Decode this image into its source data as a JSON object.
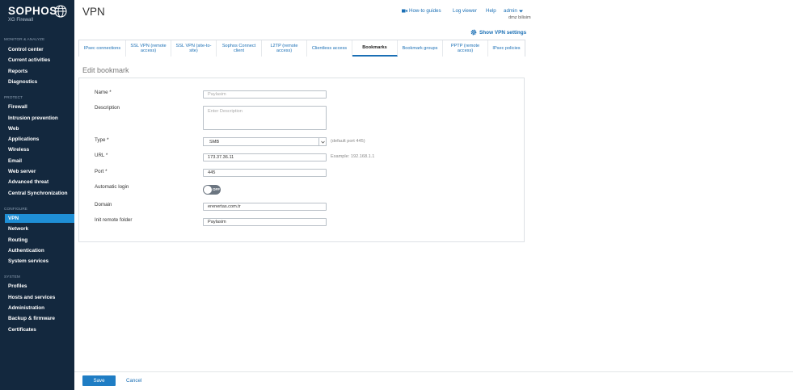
{
  "brand": {
    "name": "SOPHOS",
    "product": "XG Firewall"
  },
  "sidebar": {
    "sections": [
      {
        "label": "MONITOR & ANALYZE",
        "items": [
          "Control center",
          "Current activities",
          "Reports",
          "Diagnostics"
        ]
      },
      {
        "label": "PROTECT",
        "items": [
          "Firewall",
          "Intrusion prevention",
          "Web",
          "Applications",
          "Wireless",
          "Email",
          "Web server",
          "Advanced threat",
          "Central Synchronization"
        ]
      },
      {
        "label": "CONFIGURE",
        "items": [
          "VPN",
          "Network",
          "Routing",
          "Authentication",
          "System services"
        ]
      },
      {
        "label": "SYSTEM",
        "items": [
          "Profiles",
          "Hosts and services",
          "Administration",
          "Backup & firmware",
          "Certificates"
        ]
      }
    ],
    "active_item": "VPN"
  },
  "header": {
    "title": "VPN",
    "how_to": "How-to guides",
    "log_viewer": "Log viewer",
    "help": "Help",
    "user": "admin",
    "host": "dmz bilisim",
    "show_settings": "Show VPN settings"
  },
  "tabs": [
    {
      "label": "IPsec connections",
      "active": false
    },
    {
      "label": "SSL VPN (remote access)",
      "active": false
    },
    {
      "label": "SSL VPN (site-to-site)",
      "active": false
    },
    {
      "label": "Sophos Connect client",
      "active": false
    },
    {
      "label": "L2TP (remote access)",
      "active": false
    },
    {
      "label": "Clientless access",
      "active": false
    },
    {
      "label": "Bookmarks",
      "active": true
    },
    {
      "label": "Bookmark groups",
      "active": false
    },
    {
      "label": "PPTP (remote access)",
      "active": false
    },
    {
      "label": "IPsec policies",
      "active": false
    }
  ],
  "form": {
    "section_title": "Edit bookmark",
    "name": {
      "label": "Name *",
      "value": "",
      "placeholder": "Paylasim"
    },
    "description": {
      "label": "Description",
      "value": "",
      "placeholder": "Enter Description"
    },
    "type": {
      "label": "Type *",
      "value": "SMB",
      "hint": "(default port 445)"
    },
    "url": {
      "label": "URL *",
      "value": "173.37.36.11",
      "hint": "Example: 192.168.1.1"
    },
    "port": {
      "label": "Port *",
      "value": "445"
    },
    "auto_login": {
      "label": "Automatic login",
      "state": "OFF"
    },
    "domain": {
      "label": "Domain",
      "value": "erenertas.com.tr"
    },
    "init_folder": {
      "label": "Init remote folder",
      "value": "Paylasim"
    }
  },
  "footer": {
    "save": "Save",
    "cancel": "Cancel"
  },
  "colors": {
    "sidebar_bg": "#13283e",
    "accent": "#1f8fd6",
    "link": "#1a6fb5",
    "button": "#1f7dc4"
  }
}
